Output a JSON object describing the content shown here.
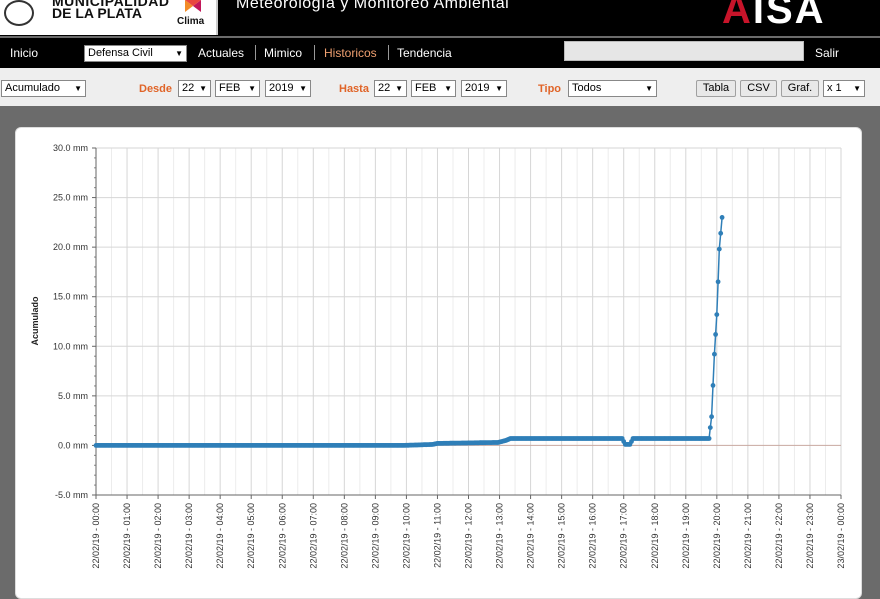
{
  "header": {
    "logo_line1": "MUNICIPALIDAD",
    "logo_line2": "DE LA PLATA",
    "logo_badge": "Clima",
    "title": "Meteorología y Monitoreo Ambiental",
    "brand_a": "A",
    "brand_rest": "ISA"
  },
  "nav": {
    "inicio": "Inicio",
    "station": "Defensa Civil",
    "actuales": "Actuales",
    "mimico": "Mimico",
    "historicos": "Historicos",
    "tendencia": "Tendencia",
    "salir": "Salir"
  },
  "filters": {
    "mode": "Acumulado",
    "desde_label": "Desde",
    "desde_day": "22",
    "desde_month": "FEB",
    "desde_year": "2019",
    "hasta_label": "Hasta",
    "hasta_day": "22",
    "hasta_month": "FEB",
    "hasta_year": "2019",
    "tipo_label": "Tipo",
    "tipo": "Todos",
    "btn_tabla": "Tabla",
    "btn_csv": "CSV",
    "btn_graf": "Graf.",
    "multiplier": "x 1"
  },
  "chart_data": {
    "type": "line",
    "ylabel": "Acumulado",
    "unit": "mm",
    "ylim": [
      -5,
      30
    ],
    "ytick_labels": [
      "30.0 mm",
      "25.0 mm",
      "20.0 mm",
      "15.0 mm",
      "10.0 mm",
      "5.0 mm",
      "0.0 mm",
      "-5.0 mm"
    ],
    "xtick_labels": [
      "22/02/19 - 00:00",
      "22/02/19 - 01:00",
      "22/02/19 - 02:00",
      "22/02/19 - 03:00",
      "22/02/19 - 04:00",
      "22/02/19 - 05:00",
      "22/02/19 - 06:00",
      "22/02/19 - 07:00",
      "22/02/19 - 08:00",
      "22/02/19 - 09:00",
      "22/02/19 - 10:00",
      "22/02/19 - 11:00",
      "22/02/19 - 12:00",
      "22/02/19 - 13:00",
      "22/02/19 - 14:00",
      "22/02/19 - 15:00",
      "22/02/19 - 16:00",
      "22/02/19 - 17:00",
      "22/02/19 - 18:00",
      "22/02/19 - 19:00",
      "22/02/19 - 20:00",
      "22/02/19 - 21:00",
      "22/02/19 - 22:00",
      "22/02/19 - 23:00",
      "23/02/19 - 00:00"
    ],
    "xlim_hours": [
      0,
      24
    ],
    "grid": true,
    "color": "#2f7fb8",
    "series": [
      {
        "points": [
          [
            0,
            0.0
          ],
          [
            9.9,
            0.0
          ],
          [
            10.85,
            0.1
          ],
          [
            11.0,
            0.2
          ],
          [
            12.95,
            0.3
          ],
          [
            13.2,
            0.5
          ],
          [
            13.35,
            0.7
          ],
          [
            16.95,
            0.7
          ],
          [
            17.05,
            0.1
          ],
          [
            17.2,
            0.1
          ],
          [
            17.3,
            0.7
          ],
          [
            19.75,
            0.7
          ],
          [
            19.83,
            2.9
          ],
          [
            19.92,
            9.2
          ],
          [
            20.0,
            13.2
          ],
          [
            20.08,
            19.8
          ],
          [
            20.17,
            23.0
          ]
        ]
      }
    ]
  }
}
